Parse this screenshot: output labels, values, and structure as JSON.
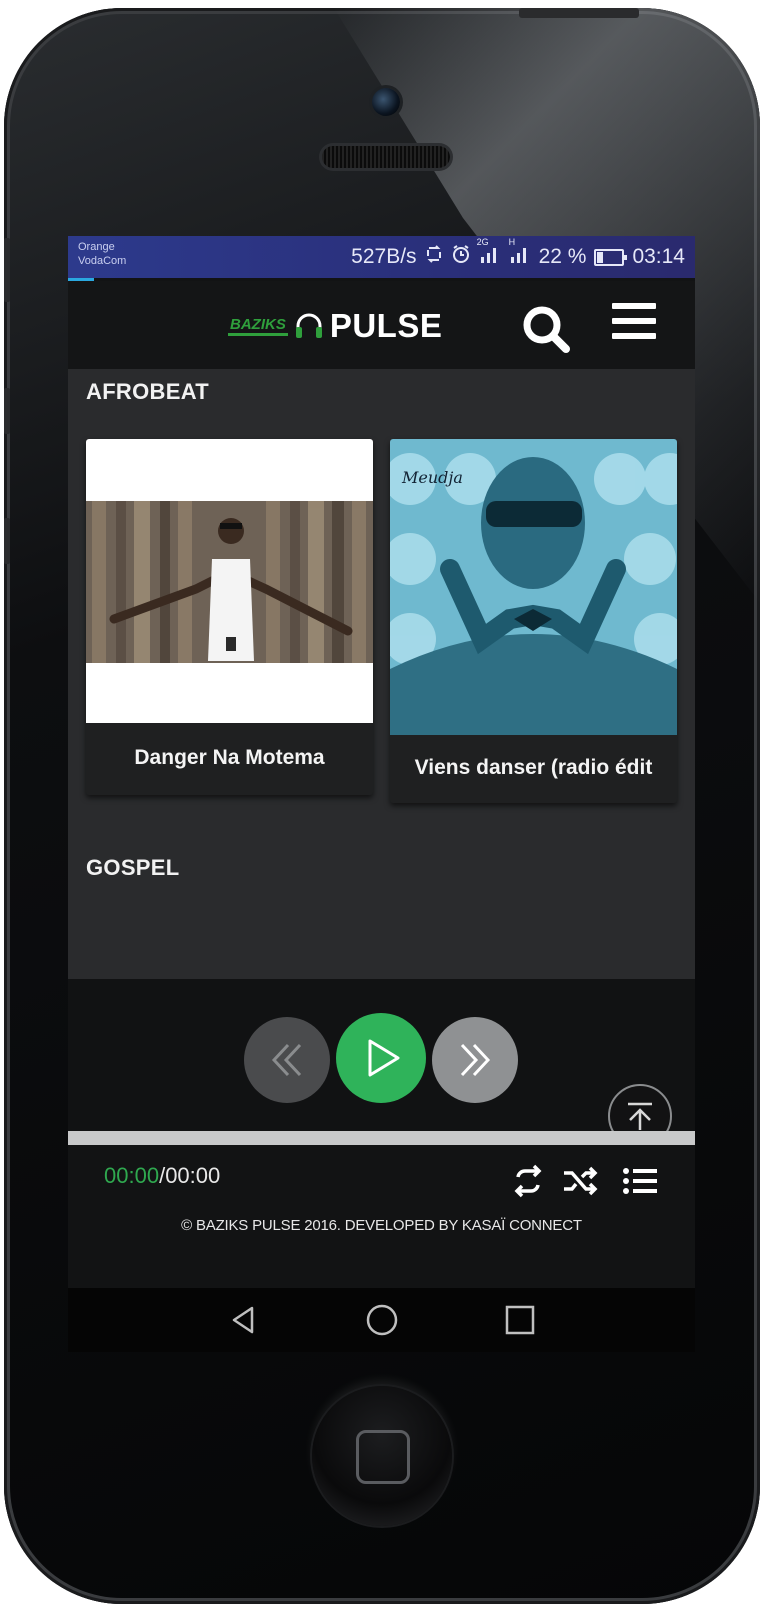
{
  "status_bar": {
    "carrier_1": "Orange",
    "carrier_2": "VodaCom",
    "speed": "527B/s",
    "net_1": "2G",
    "net_2": "H",
    "battery": "22 %",
    "time": "03:14"
  },
  "header": {
    "logo_baziks": "BAZIKS",
    "logo_pulse": "PULSE",
    "icons": [
      "search-icon",
      "hamburger-menu-icon"
    ]
  },
  "sections": [
    {
      "title": "AFROBEAT",
      "tracks": [
        {
          "title": "Danger Na Motema",
          "cover": "artist-against-wooden-fence"
        },
        {
          "title": "Viens danser (radio édit",
          "cover": "blue-toned-artist-with-sunglasses",
          "cover_text": "Meudja"
        }
      ]
    },
    {
      "title": "GOSPEL",
      "tracks": []
    }
  ],
  "player": {
    "current_time": "00:00",
    "separator": "/",
    "total_time": "00:00",
    "progress": 0,
    "controls": [
      "previous-icon",
      "play-icon",
      "next-icon"
    ],
    "extra_icons": [
      "repeat-icon",
      "shuffle-icon",
      "playlist-icon",
      "scroll-to-top-icon"
    ],
    "accent_color": "#2fb35a"
  },
  "footer": {
    "copyright": "© BAZIKS PULSE 2016. DEVELOPED BY KASAÏ CONNECT"
  },
  "android_nav": [
    "back-icon",
    "home-icon",
    "recents-icon"
  ]
}
